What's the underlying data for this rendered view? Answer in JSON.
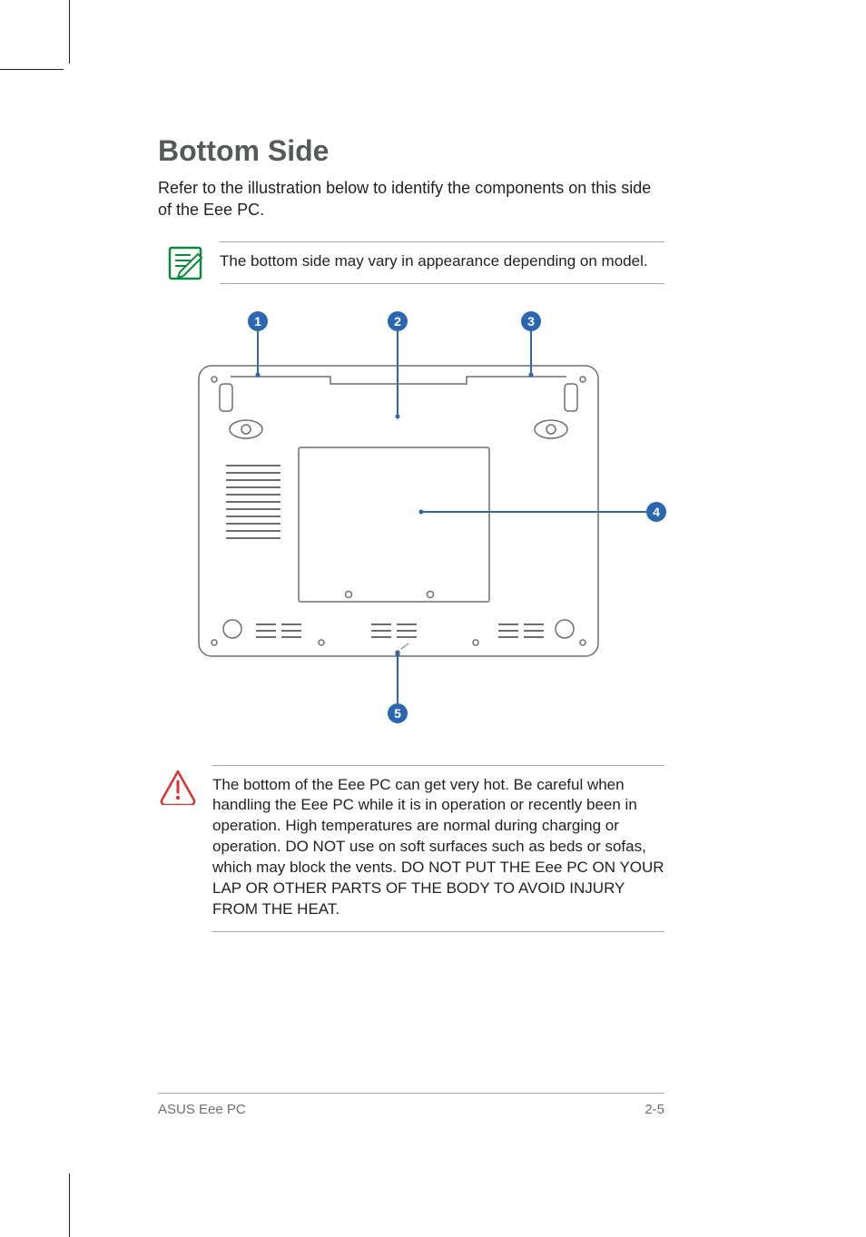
{
  "heading": "Bottom Side",
  "intro": "Refer to the illustration below to identify the components on this side of the Eee PC.",
  "note": {
    "text": "The bottom side may vary in appearance depending on model."
  },
  "callouts": {
    "c1": "1",
    "c2": "2",
    "c3": "3",
    "c4": "4",
    "c5": "5"
  },
  "warning": {
    "text": "The bottom of the Eee PC can get very hot. Be careful when handling the Eee PC while it is in operation or recently been in operation. High temperatures are normal during charging or operation. DO NOT use on soft surfaces such as beds or sofas, which may block the vents. DO NOT PUT THE Eee PC ON YOUR LAP OR OTHER PARTS OF THE BODY TO AVOID INJURY FROM THE HEAT."
  },
  "footer": {
    "left": "ASUS Eee PC",
    "right": "2-5"
  }
}
